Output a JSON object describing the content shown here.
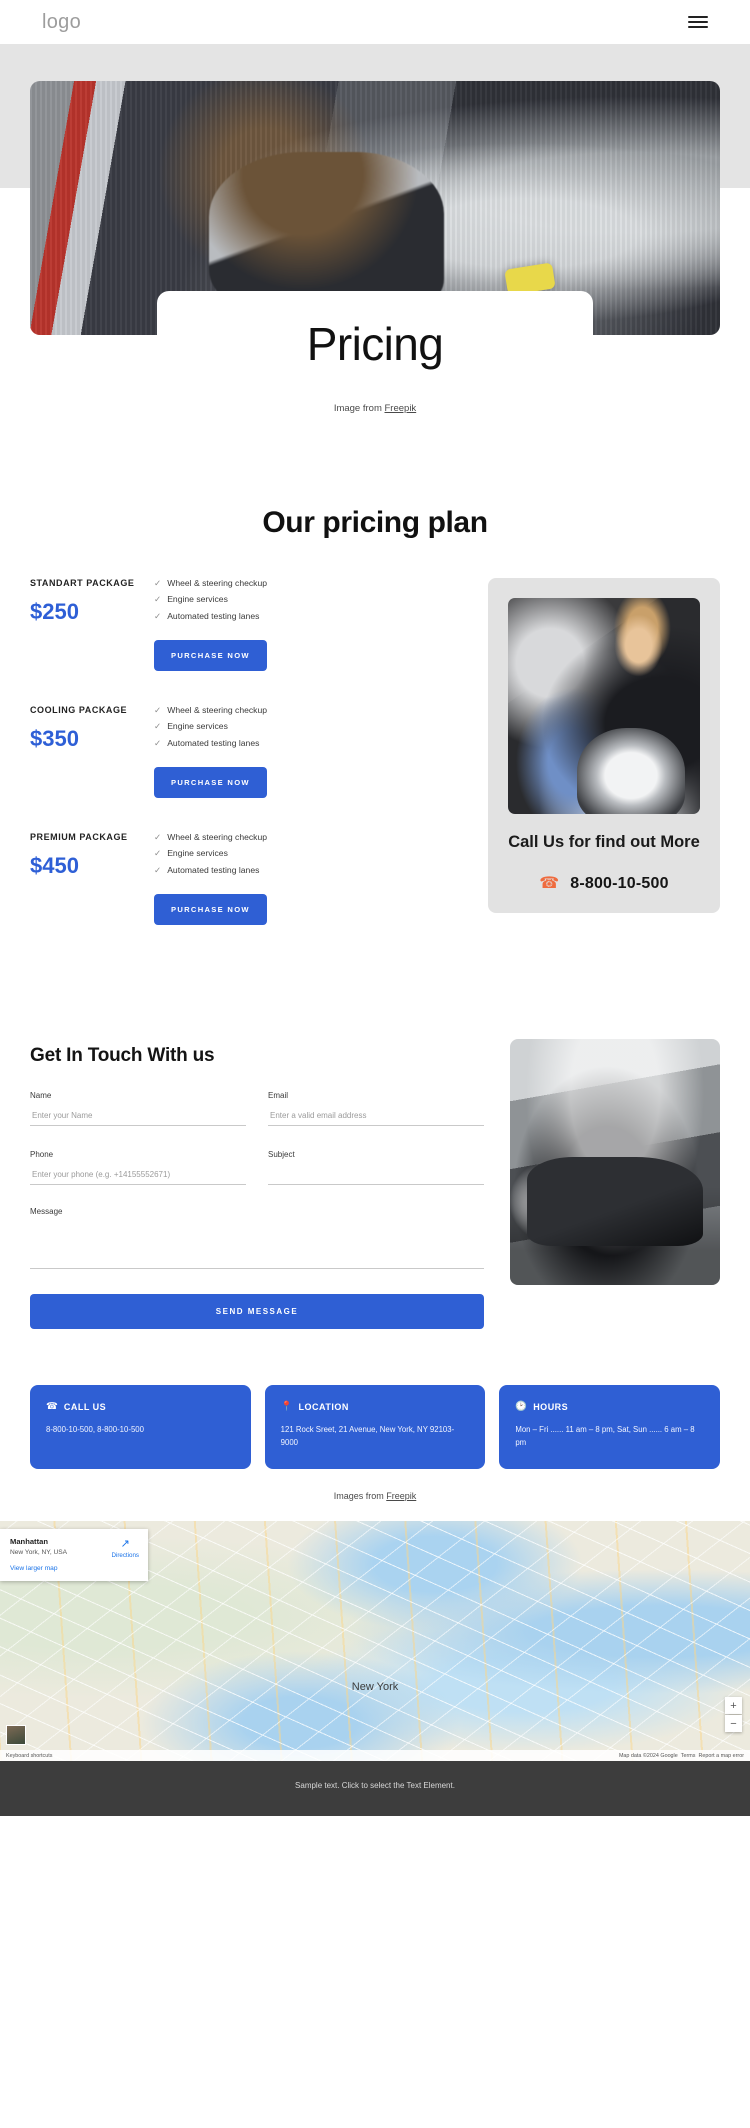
{
  "nav": {
    "logo": "logo",
    "menu_icon": "hamburger-icon"
  },
  "hero": {
    "title": "Pricing",
    "credit_prefix": "Image from ",
    "credit_link": "Freepik"
  },
  "pricing": {
    "section_title": "Our pricing plan",
    "plans": [
      {
        "name": "STANDART  PACKAGE",
        "price": "$250",
        "features": [
          "Wheel & steering checkup",
          "Engine services",
          "Automated testing lanes"
        ],
        "cta": "PURCHASE NOW"
      },
      {
        "name": "COOLING PACKAGE",
        "price": "$350",
        "features": [
          "Wheel & steering checkup",
          "Engine services",
          "Automated testing lanes"
        ],
        "cta": "PURCHASE NOW"
      },
      {
        "name": "PREMIUM PACKAGE",
        "price": "$450",
        "features": [
          "Wheel & steering checkup",
          "Engine services",
          "Automated testing lanes"
        ],
        "cta": "PURCHASE NOW"
      }
    ],
    "call_card": {
      "title": "Call Us for find out More",
      "phone": "8-800-10-500",
      "phone_icon": "phone-icon",
      "accent": "#ef6b3e"
    }
  },
  "contact": {
    "title": "Get In Touch With us",
    "fields": {
      "name_label": "Name",
      "name_placeholder": "Enter your Name",
      "email_label": "Email",
      "email_placeholder": "Enter a valid email address",
      "phone_label": "Phone",
      "phone_placeholder": "Enter your phone (e.g. +14155552671)",
      "subject_label": "Subject",
      "subject_placeholder": "",
      "message_label": "Message",
      "message_placeholder": ""
    },
    "submit": "SEND MESSAGE"
  },
  "info_cards": [
    {
      "icon": "phone-icon",
      "title": "CALL US",
      "body": "8-800-10-500,\n8-800-10-500"
    },
    {
      "icon": "location-pin-icon",
      "title": "LOCATION",
      "body": "121 Rock Sreet, 21 Avenue, New York, NY 92103-9000"
    },
    {
      "icon": "clock-icon",
      "title": "HOURS",
      "body": "Mon – Fri ...... 11 am – 8 pm, Sat, Sun  ......  6 am – 8 pm"
    }
  ],
  "images_credit": {
    "prefix": "Images from ",
    "link": "Freepik"
  },
  "map": {
    "place": "Manhattan",
    "subtitle": "New York, NY, USA",
    "view_larger": "View larger map",
    "directions": "Directions",
    "city_label": "New York",
    "zoom_in": "+",
    "zoom_out": "−",
    "shortcuts": "Keyboard shortcuts",
    "attribution": "Map data ©2024 Google",
    "terms": "Terms",
    "report": "Report a map error"
  },
  "footer": {
    "text": "Sample text. Click to select the Text Element."
  },
  "colors": {
    "brand_blue": "#2f5fd4",
    "price_blue": "#2e5fd6",
    "accent_orange": "#ef6b3e"
  }
}
